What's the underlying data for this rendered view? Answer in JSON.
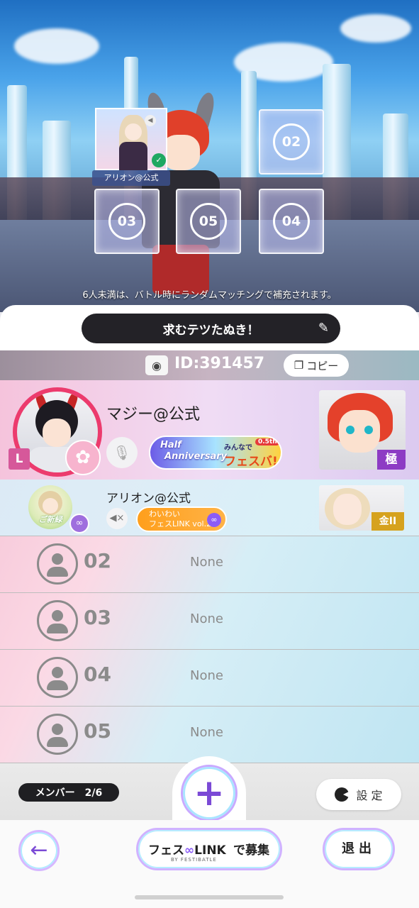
{
  "scene": {
    "filled_slot_name": "アリオン@公式",
    "slot_numbers": [
      "02",
      "03",
      "05",
      "04"
    ],
    "notice": "6人未満は、バトル時にランダムマッチングで補充されます。"
  },
  "recruit": {
    "title": "求むテツたぬき！"
  },
  "room": {
    "id_label": "ID:391457",
    "copy_label": "コピー"
  },
  "leader": {
    "name": "マジー@公式",
    "badge": "L",
    "banner_line1": "Half",
    "banner_line2": "Anniversary",
    "banner_tag": "0.5th",
    "banner_right_top": "みんなで",
    "banner_right_bottom": "フェスバ!",
    "rank": "極"
  },
  "member": {
    "name": "アリオン@公式",
    "avatar_tag": "ご新緑",
    "link_line1": "わいわい",
    "link_line2": "フェスLINK vol.2",
    "rank": "金II"
  },
  "empty_slots": [
    {
      "num": "02",
      "status": "None"
    },
    {
      "num": "03",
      "status": "None"
    },
    {
      "num": "04",
      "status": "None"
    },
    {
      "num": "05",
      "status": "None"
    }
  ],
  "bottom": {
    "member_count": "メンバー　2/6",
    "plus": "+",
    "settings_label": "設 定"
  },
  "footer": {
    "fes_logo_a": "フェス",
    "fes_logo_b": "LINK",
    "fes_sub": "BY FESTIBATLE",
    "fes_recruit": "で募集",
    "exit_label": "退出"
  },
  "colors": {
    "accent_purple": "#8b5cf6",
    "leader_ring": "#ec3b6d",
    "dark_bar": "#232227"
  }
}
